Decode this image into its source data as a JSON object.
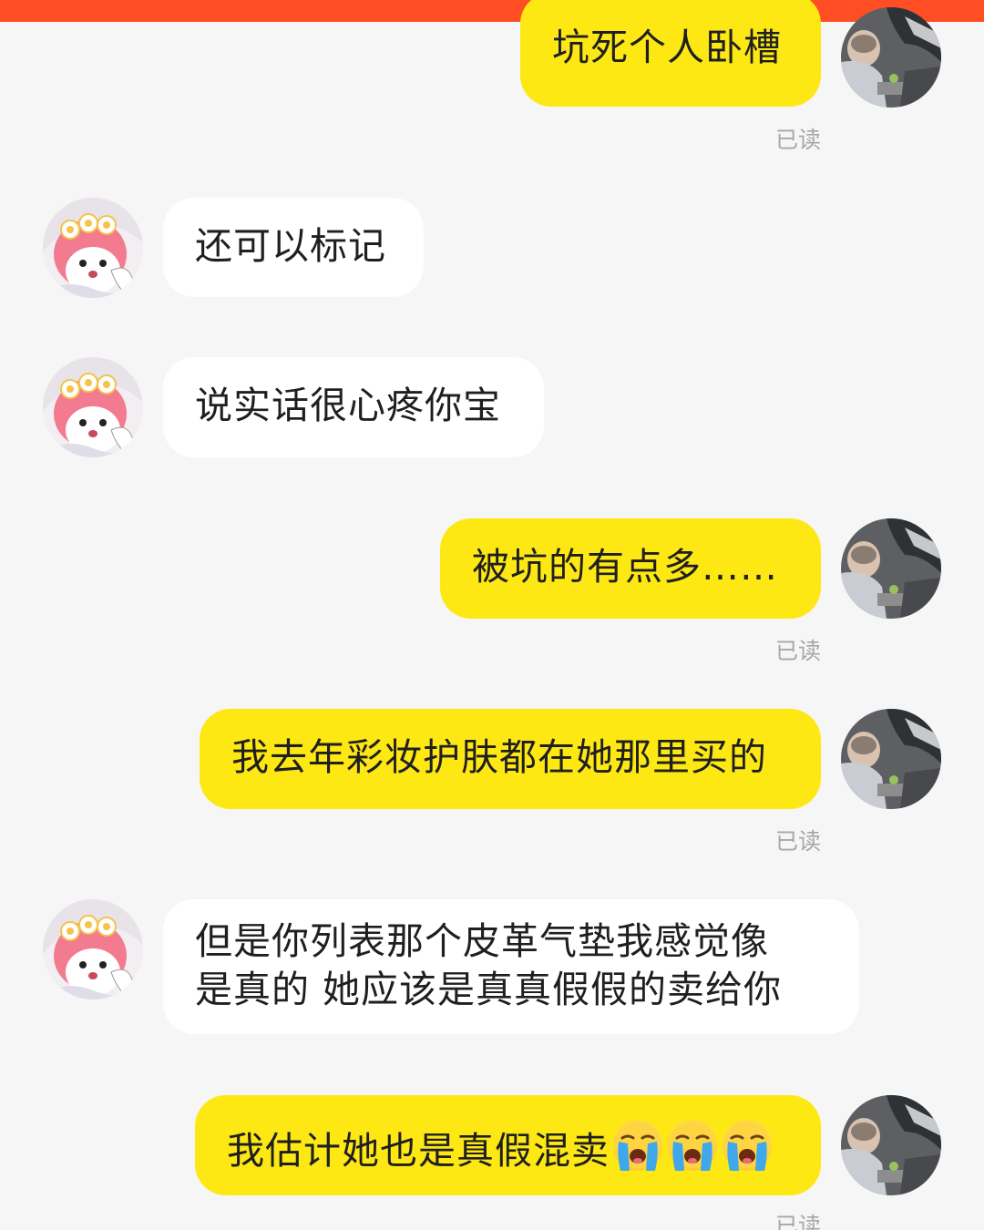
{
  "colors": {
    "top_bar": "#ff4e24",
    "my_bubble": "#fde814",
    "their_bubble": "#ffffff",
    "background": "#f6f6f6",
    "read_receipt": "#a7a7a7"
  },
  "messages": [
    {
      "sender": "me",
      "text": "坑死个人卧槽",
      "status": "已读"
    },
    {
      "sender": "them",
      "text": "还可以标记"
    },
    {
      "sender": "them",
      "text": "说实话很心疼你宝"
    },
    {
      "sender": "me",
      "text": "被坑的有点多……",
      "status": "已读"
    },
    {
      "sender": "me",
      "text": "我去年彩妆护肤都在她那里买的",
      "status": "已读"
    },
    {
      "sender": "them",
      "lines": [
        "但是你列表那个皮革气垫我感觉像",
        "是真的 她应该是真真假假的卖给你"
      ]
    },
    {
      "sender": "me",
      "text": "我估计她也是真假混卖",
      "emoji": [
        "loudly-crying-face",
        "loudly-crying-face",
        "loudly-crying-face"
      ],
      "status": "已读"
    }
  ]
}
